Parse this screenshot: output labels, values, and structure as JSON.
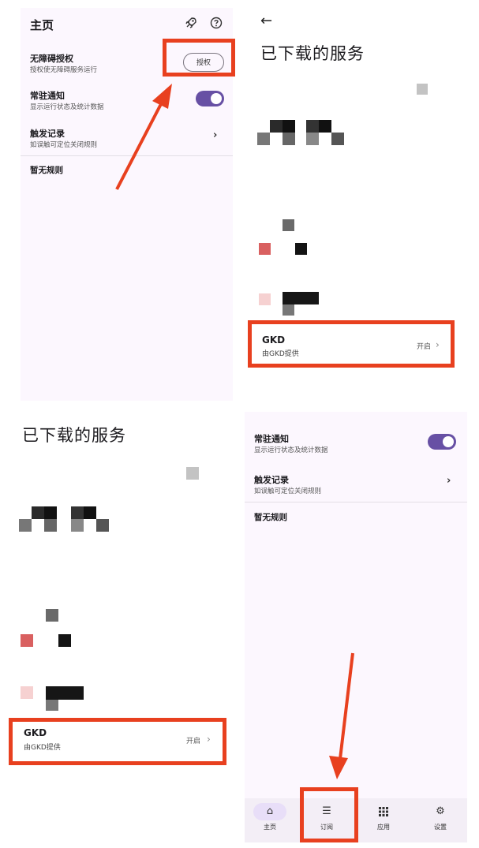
{
  "colors": {
    "background": "#fcf7fe",
    "accent": "#6750a4",
    "annotation_red": "#e8401f"
  },
  "home": {
    "title": "主页",
    "icons": [
      "rocket-icon",
      "help-circle-icon"
    ],
    "accessibility": {
      "title": "无障碍授权",
      "subtitle": "授权使无障碍服务运行",
      "button": "授权"
    },
    "resident_notice": {
      "title": "常驻通知",
      "subtitle": "显示运行状态及统计数据",
      "enabled": true
    },
    "trigger_log": {
      "title": "触发记录",
      "subtitle": "如误触可定位关闭规则"
    },
    "empty_rules": "暂无规则"
  },
  "services": {
    "back_icon": "arrow-left-icon",
    "title": "已下载的服务",
    "item": {
      "name": "GKD",
      "subtitle": "由GKD提供",
      "status": "开启"
    }
  },
  "nav": {
    "items": [
      {
        "label": "主页",
        "icon": "home-icon",
        "active": true
      },
      {
        "label": "订阅",
        "icon": "list-icon",
        "active": false
      },
      {
        "label": "应用",
        "icon": "apps-grid-icon",
        "active": false
      },
      {
        "label": "设置",
        "icon": "gear-icon",
        "active": false
      }
    ]
  }
}
